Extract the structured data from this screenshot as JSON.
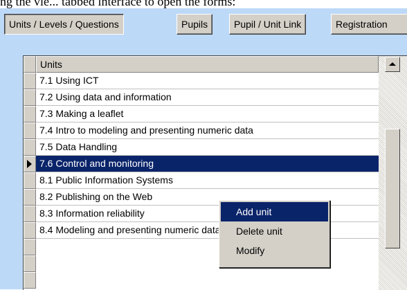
{
  "top_text": "ng the vie... tabbed interface to open the forms:",
  "tabs": [
    {
      "label": "Units / Levels / Questions",
      "active": true
    },
    {
      "label": "Pupils",
      "active": false
    },
    {
      "label": "Pupil / Unit Link",
      "active": false
    },
    {
      "label": "Registration",
      "active": false
    }
  ],
  "grid": {
    "column_header": "Units",
    "selected_index": 5,
    "rows": [
      "7.1 Using ICT",
      "7.2 Using data and information",
      "7.3 Making a leaflet",
      "7.4 Intro to modeling and presenting numeric data",
      "7.5 Data Handling",
      "7.6 Control and monitoring",
      "8.1 Public Information Systems",
      "8.2 Publishing on the Web",
      "8.3 Information reliability",
      "8.4 Modeling and presenting numeric data"
    ]
  },
  "context_menu": {
    "items": [
      "Add unit",
      "Delete unit",
      "Modify"
    ],
    "highlighted_index": 0
  },
  "icons": {
    "record_pointer": "current-record-arrow-icon",
    "scroll_up": "scroll-up-arrow-icon"
  },
  "colors": {
    "panel_background": "#bdd9f8",
    "selection": "#0a246a",
    "control_face": "#d4d0c8"
  }
}
